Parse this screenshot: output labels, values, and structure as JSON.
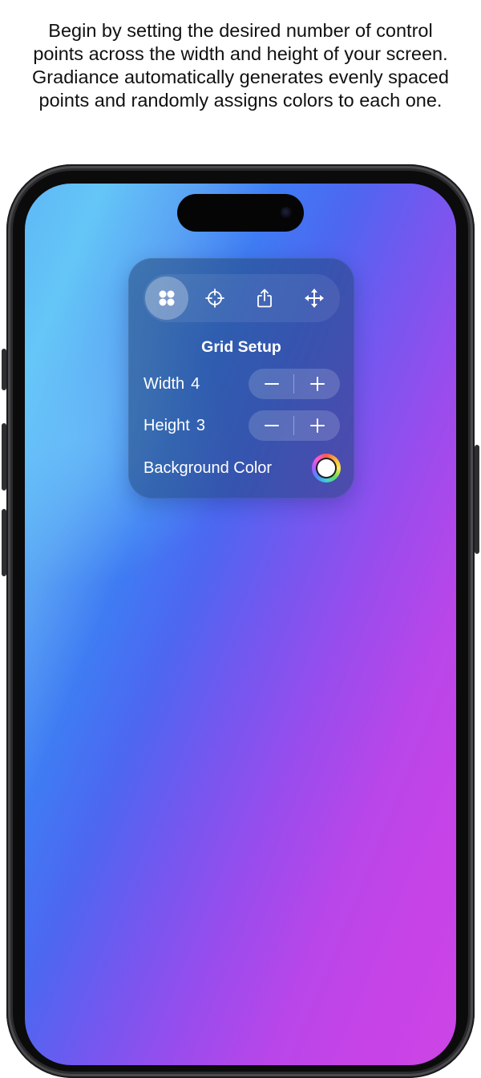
{
  "caption": "Begin by setting the desired number of control points across the width and height of your screen. Gradiance automatically generates evenly spaced points and randomly assigns colors to each one.",
  "toolbar": {
    "items": [
      {
        "icon": "grid-points-icon",
        "active": true
      },
      {
        "icon": "crosshair-icon",
        "active": false
      },
      {
        "icon": "share-icon",
        "active": false
      },
      {
        "icon": "move-arrows-icon",
        "active": false
      }
    ]
  },
  "panel": {
    "title": "Grid Setup",
    "width": {
      "label": "Width",
      "value": "4"
    },
    "height": {
      "label": "Height",
      "value": "3"
    },
    "background": {
      "label": "Background Color",
      "color": "#ffffff"
    }
  },
  "colors": {
    "gradient_left": "#64c6f7",
    "gradient_mid": "#4d67f1",
    "gradient_right": "#cc44e6"
  }
}
